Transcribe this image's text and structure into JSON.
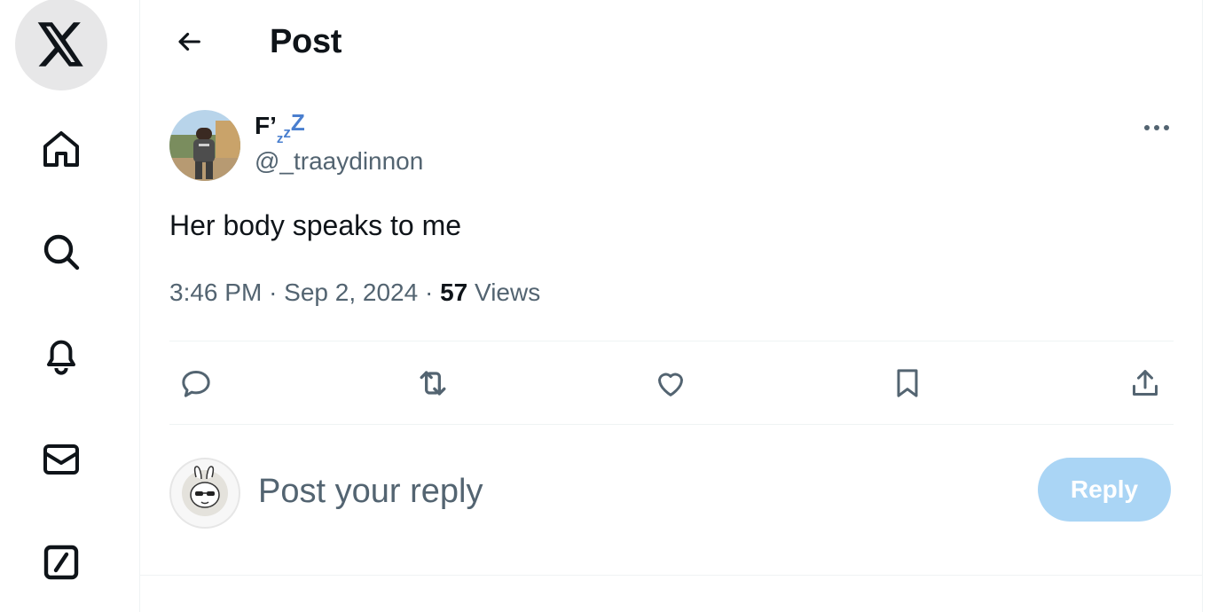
{
  "header": {
    "title": "Post"
  },
  "nav": {
    "items": [
      "x-logo-icon",
      "home-icon",
      "search-icon",
      "bell-icon",
      "mail-icon",
      "grok-icon"
    ]
  },
  "tweet": {
    "display_name": "F’",
    "name_zzz": [
      "z",
      "z",
      "Z"
    ],
    "handle": "@_traaydinnon",
    "text": "Her body speaks to me",
    "time": "3:46 PM",
    "date": "Sep 2, 2024",
    "separator": "·",
    "views_count": "57",
    "views_label": "Views"
  },
  "actions": [
    "reply-icon",
    "retweet-icon",
    "like-icon",
    "bookmark-icon",
    "share-icon"
  ],
  "composer": {
    "placeholder": "Post your reply",
    "button_label": "Reply"
  },
  "colors": {
    "accent": "#1d9bf0",
    "reply_button_disabled": "#8ec7f2",
    "secondary_text": "#536471",
    "name_zzz": "#4a7fcf"
  }
}
